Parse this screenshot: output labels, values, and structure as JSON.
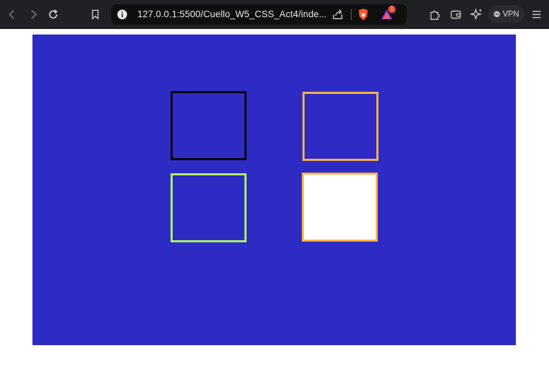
{
  "browser": {
    "url": "127.0.0.1:5500/Cuello_W5_CSS_Act4/inde...",
    "rewards_badge": "1",
    "vpn_label": "VPN"
  },
  "boxes": [
    {
      "name": "box-black-border",
      "border_color": "#000000",
      "fill": "none"
    },
    {
      "name": "box-orange-border",
      "border_color": "#ffb347",
      "fill": "none"
    },
    {
      "name": "box-green-border",
      "border_color": "#adff62",
      "fill": "none"
    },
    {
      "name": "box-white-filled",
      "border_color": "#ffb347",
      "fill": "#ffffff"
    }
  ],
  "colors": {
    "canvas_background": "#2e2bc5",
    "toolbar_background": "#202124"
  }
}
